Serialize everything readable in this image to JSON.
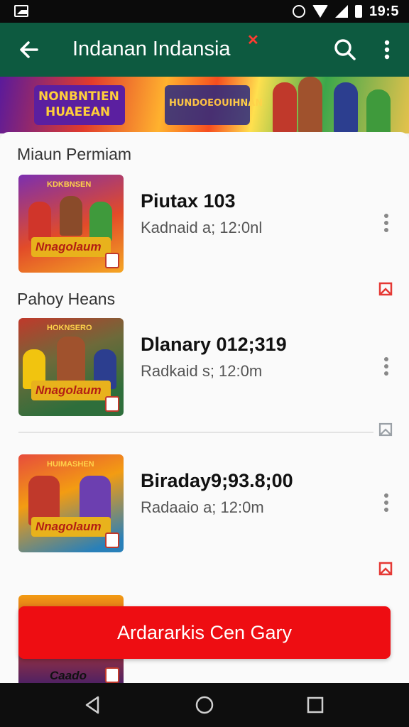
{
  "status_bar": {
    "time": "19:5",
    "icons": [
      "gallery-icon",
      "alarm-icon",
      "wifi-icon",
      "signal-icon",
      "battery-icon"
    ]
  },
  "app_bar": {
    "title": "Indanan Indansia",
    "back_icon": "arrow-left-icon",
    "search_icon": "search-icon",
    "menu_icon": "more-vertical-icon",
    "accent": "#0d5a40",
    "mark_color": "#ff3b30"
  },
  "banner": {
    "line1": "NONBNTIEN",
    "line2": "HUAEEAN",
    "line3": "HUNDOEOUIHNAN"
  },
  "sections": [
    {
      "title": "Miaun Permiam"
    },
    {
      "title": "Pahoy Heans"
    }
  ],
  "items": [
    {
      "title": "Piutax 103",
      "subtitle": "Kadnaid a; 12:0nl",
      "thumb_caption": "Nnagolaum",
      "thumb_header": "KDKBNSEN",
      "more_icon": "more-vertical-icon"
    },
    {
      "title": "Dlanary 012;319",
      "subtitle": "Radkaid s; 12:0m",
      "thumb_caption": "Nnagolaum",
      "thumb_header": "HOKNSERO",
      "more_icon": "more-vertical-icon"
    },
    {
      "title": "Biraday9;93.8;00",
      "subtitle": "Radaaio a; 12:0m",
      "thumb_caption": "Nnagolaum",
      "thumb_header": "HUIMASHEN",
      "more_icon": "more-vertical-icon"
    },
    {
      "thumb_caption": "Caado"
    }
  ],
  "bookmarks": [
    "bookmark-icon",
    "bookmark-outline-icon",
    "bookmark-icon"
  ],
  "cta": {
    "label": "Ardararkis Cen Gary",
    "color": "#ee0d12"
  },
  "nav_bar": {
    "icons": [
      "nav-back-icon",
      "nav-home-icon",
      "nav-recents-icon"
    ]
  }
}
